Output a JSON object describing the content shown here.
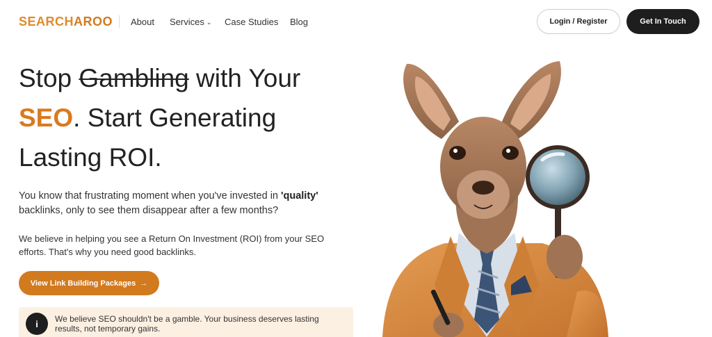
{
  "header": {
    "logo": {
      "part1": "SEARCH",
      "part2": "AROO"
    },
    "nav": {
      "about": "About",
      "services": "Services",
      "case_studies": "Case Studies",
      "blog": "Blog"
    },
    "login_label": "Login / Register",
    "touch_label": "Get In Touch"
  },
  "hero": {
    "line1_a": "Stop",
    "line1_strike": "Gambling",
    "line1_b": "with Your",
    "line2_seo": "SEO",
    "line2_rest": ". Start Generating",
    "line3": "Lasting ROI.",
    "p1_a": "You know that frustrating moment when you've invested in ",
    "p1_bold": "'quality'",
    "p1_b": " backlinks, only to see them disappear after a few months?",
    "p2": "We believe in helping you see a Return On Investment (ROI) from your SEO efforts. That's why you need good backlinks.",
    "cta_label": "View Link Building Packages",
    "cta_arrow": "→",
    "notice_icon": "i",
    "notice_text": "We believe SEO shouldn't be a gamble. Your business deserves lasting results, not temporary gains."
  },
  "colors": {
    "brand": "#d27a1e",
    "dark": "#1e1e1e",
    "notice_bg": "#fcf0e2"
  },
  "icons": {
    "services_chevron": "chevron-down-icon",
    "cta_arrow": "arrow-right-icon",
    "notice": "info-icon"
  }
}
